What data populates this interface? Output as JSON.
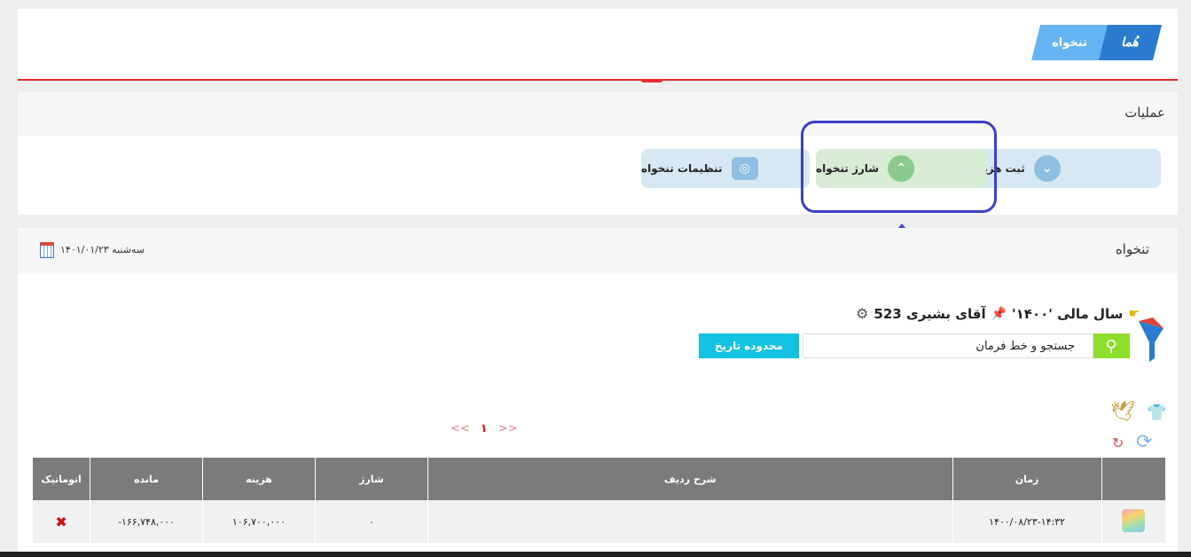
{
  "breadcrumb": {
    "app": "هُما",
    "page": "تنخواه"
  },
  "operations": {
    "title": "عملیات",
    "buttons": [
      {
        "label": "ثبت هزینه",
        "icon": "chevron-down-icon"
      },
      {
        "label": "شارژ تنخواه",
        "icon": "chevron-up-icon"
      },
      {
        "label": "تنظیمات تنخواه",
        "icon": "money-icon"
      }
    ]
  },
  "main": {
    "title": "تنخواه",
    "date": "سه‌شنبه ۱۴۰۱/۰۱/۲۳",
    "fiscal_year": "سال مالی '۱۴۰۰'",
    "user": "آقای بشیری 523",
    "search": {
      "value": "جستجو و خط فرمان"
    },
    "date_range_button": "محدوده تاریخ",
    "pager": {
      "prev": "<<",
      "current": "۱",
      "next": ">>"
    }
  },
  "table": {
    "headers": [
      "",
      "زمان",
      "شرح ردیف",
      "شارژ",
      "هزینه",
      "مانده",
      "اتوماتیک"
    ],
    "rows": [
      {
        "time": "۱۴۰۰/۰۸/۲۳-۱۴:۳۲",
        "desc": "",
        "charge": "۰",
        "cost": "۱۰۶,۷۰۰,۰۰۰",
        "balance": "۱۶۶,۷۴۸,۰۰۰-",
        "auto": "✖"
      }
    ]
  },
  "colors": {
    "accent": "#2a7bcf",
    "highlight": "#3b41c6",
    "search_green": "#8ede2d",
    "range_cyan": "#12c2e0"
  }
}
